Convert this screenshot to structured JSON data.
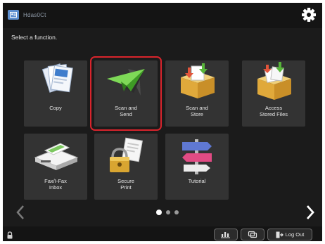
{
  "header": {
    "user_name": "Hdas0Ct",
    "user_icon": "user-card-icon",
    "settings_icon": "gear-icon"
  },
  "prompt": "Select a function.",
  "tiles": [
    {
      "label": "Copy",
      "icon": "copy-documents-icon"
    },
    {
      "label": "Scan and\nSend",
      "icon": "paper-plane-icon",
      "selected": true
    },
    {
      "label": "Scan and\nStore",
      "icon": "box-download-icon"
    },
    {
      "label": "Access\nStored Files",
      "icon": "file-box-icon"
    },
    {
      "label": "Fax/I-Fax\nInbox",
      "icon": "fax-tray-icon"
    },
    {
      "label": "Secure\nPrint",
      "icon": "padlock-document-icon"
    },
    {
      "label": "Tutorial",
      "icon": "signpost-icon"
    }
  ],
  "pagination": {
    "current": 1,
    "total": 3
  },
  "footer": {
    "logout_label": "Log Out",
    "icons": [
      "lock-icon",
      "counter-icon",
      "status-monitor-icon",
      "logout-icon"
    ]
  },
  "colors": {
    "background": "#1b1b1b",
    "tile": "#333333",
    "highlight": "#d9242c",
    "accent_green": "#5fc23a"
  }
}
